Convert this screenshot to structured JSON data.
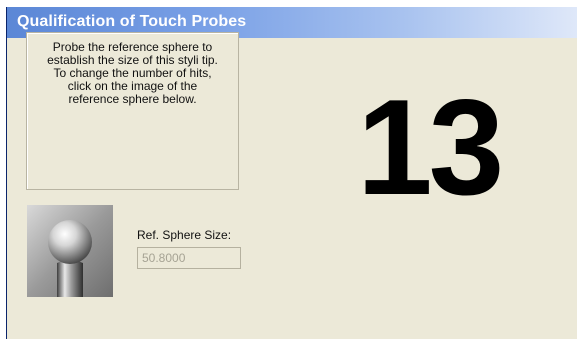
{
  "window": {
    "title": "Qualification of Touch Probes"
  },
  "instructions": {
    "text": "Probe the reference sphere to\nestablish the size of this styli tip.\nTo change the number of hits,\nclick on the image of the\nreference sphere below."
  },
  "hit_count": {
    "value": "13"
  },
  "reference_sphere": {
    "icon": "reference-sphere-image",
    "size_label": "Ref. Sphere Size:",
    "size_value": "50.8000",
    "size_field_enabled": false
  },
  "colors": {
    "window_background": "#ece9d8",
    "titlebar_start": "#5b87d6",
    "titlebar_end": "#dfe8f9",
    "title_text": "#ffffff",
    "disabled_text": "#a6a394"
  }
}
